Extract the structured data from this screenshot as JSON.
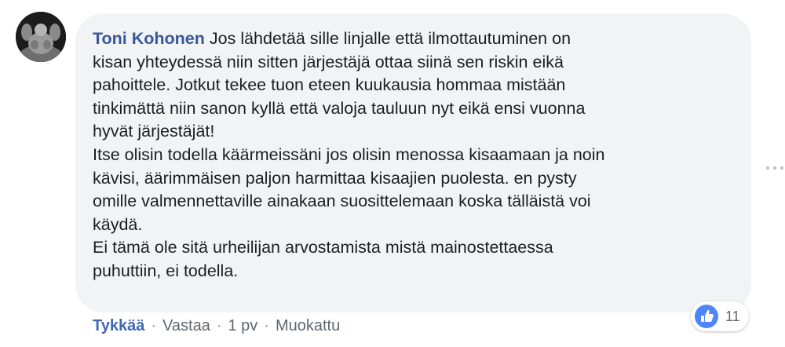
{
  "comment": {
    "author": "Toni Kohonen",
    "lines": [
      "Jos lähdetää sille linjalle että ilmottautuminen on",
      "kisan yhteydessä niin sitten järjestäjä ottaa siinä sen riskin eikä",
      "pahoittele. Jotkut tekee tuon eteen kuukausia hommaa mistään",
      "tinkimättä niin sanon kyllä että valoja tauluun nyt eikä ensi vuonna",
      "hyvät järjestäjät!",
      "Itse olisin todella käärmeissäni jos olisin menossa kisaamaan ja noin",
      "kävisi, äärimmäisen paljon harmittaa kisaajien puolesta. en pysty",
      "omille valmennettaville ainakaan suosittelemaan koska tälläistä voi",
      "käydä.",
      "Ei tämä ole sitä urheilijan arvostamista mistä mainostettaessa",
      "puhuttiin, ei todella."
    ]
  },
  "reactions": {
    "icon": "like-thumb-icon",
    "count": "11",
    "color": "#4267b2"
  },
  "actions": {
    "like": "Tykkää",
    "separator": "·",
    "reply": "Vastaa",
    "time": "1 pv",
    "edited": "Muokattu"
  }
}
